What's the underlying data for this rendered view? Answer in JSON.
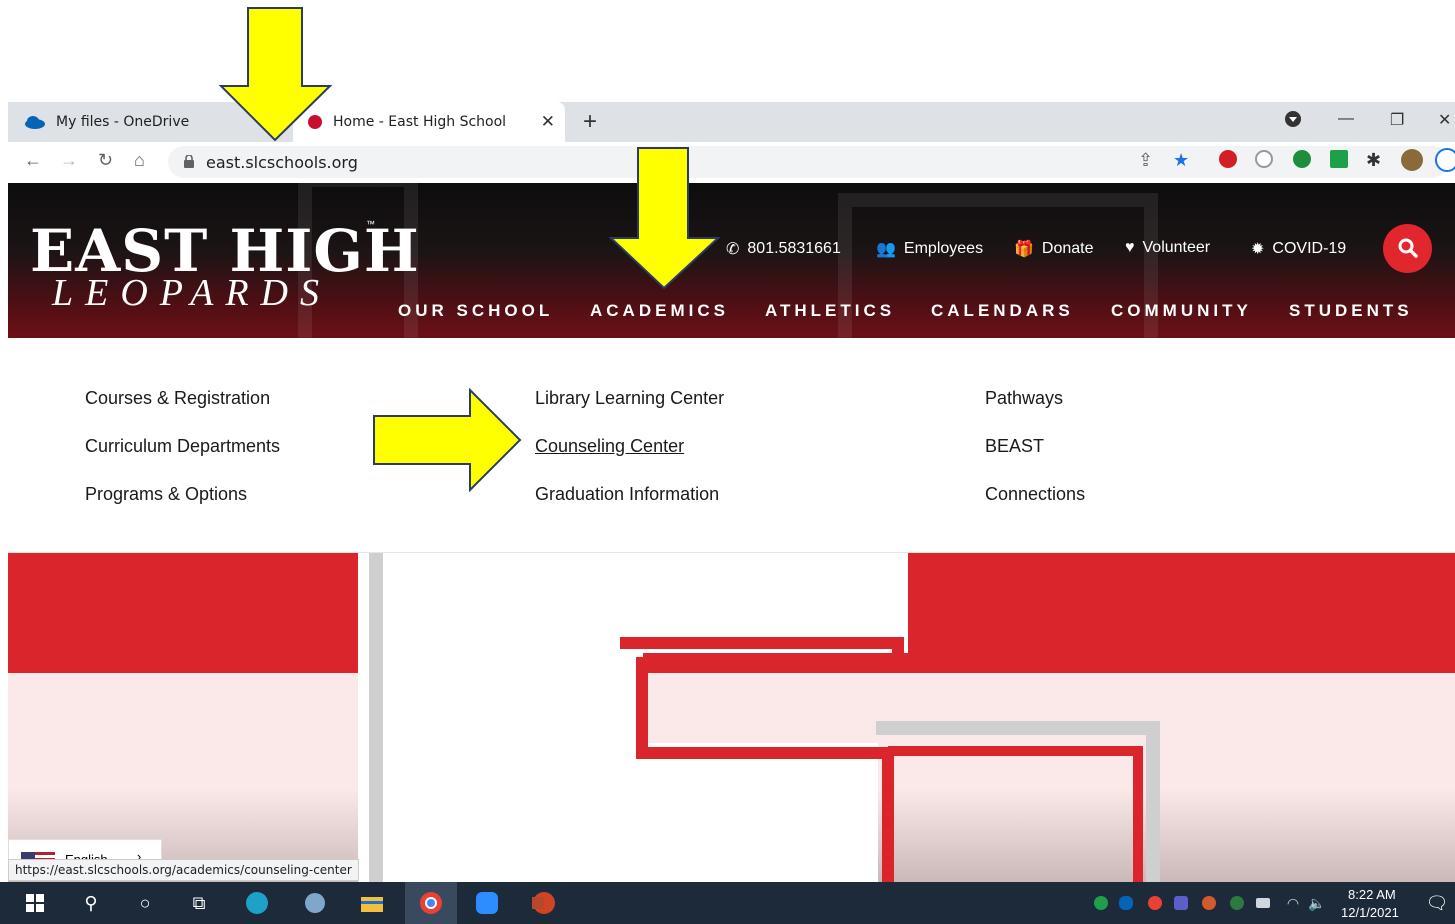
{
  "browser": {
    "tabs": [
      {
        "label": "My files - OneDrive",
        "active": false
      },
      {
        "label": "Home - East High School",
        "active": true
      }
    ],
    "url": "east.slcschools.org",
    "status_url": "https://east.slcschools.org/academics/counseling-center",
    "icons": [
      "back-icon",
      "forward-icon",
      "reload-icon",
      "home-icon",
      "lock-icon",
      "share-icon",
      "star-icon",
      "adblock-icon",
      "extension-icon",
      "puzzle-icon",
      "profile-icon",
      "menu-icon"
    ]
  },
  "site": {
    "logo_top": "EAST HIGH",
    "logo_bottom": "LEOPARDS",
    "logo_tm": "™",
    "utility": {
      "phone": "801.5831661",
      "employees": "Employees",
      "donate": "Donate",
      "volunteer": "Volunteer",
      "covid": "COVID-19"
    },
    "menu": [
      "OUR SCHOOL",
      "ACADEMICS",
      "ATHLETICS",
      "CALENDARS",
      "COMMUNITY",
      "STUDENTS"
    ],
    "dropdown": {
      "col1": [
        "Courses & Registration",
        "Curriculum Departments",
        "Programs & Options"
      ],
      "col2": [
        "Library Learning Center",
        "Counseling Center",
        "Graduation Information"
      ],
      "col3": [
        "Pathways",
        "BEAST",
        "Connections"
      ]
    },
    "language": "English"
  },
  "taskbar": {
    "time": "8:22 AM",
    "date": "12/1/2021"
  },
  "colors": {
    "accent_red": "#e1262d",
    "arrow_yellow": "#ffff00",
    "taskbar": "#1d2a3a"
  }
}
